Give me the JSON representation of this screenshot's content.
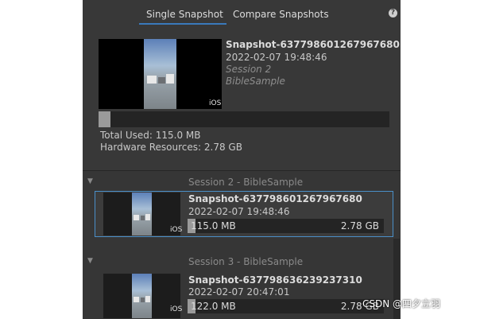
{
  "tabs": [
    {
      "label": "Single Snapshot",
      "active": true
    },
    {
      "label": "Compare Snapshots",
      "active": false
    }
  ],
  "help_icon": "?",
  "selected_snapshot": {
    "name": "Snapshot-637798601267967680",
    "date": "2022-02-07 19:48:46",
    "session": "Session 2",
    "project": "BibleSample",
    "platform": "iOS",
    "usage_fraction": 0.04,
    "total_used": "Total Used: 115.0 MB",
    "hardware_resources": "Hardware Resources: 2.78 GB"
  },
  "sessions": [
    {
      "header": "Session 2 - BibleSample",
      "snapshots": [
        {
          "name": "Snapshot-637798601267967680",
          "date": "2022-02-07 19:48:46",
          "platform": "iOS",
          "used": "115.0 MB",
          "total": "2.78 GB",
          "usage_fraction": 0.04,
          "selected": true
        }
      ]
    },
    {
      "header": "Session 3 - BibleSample",
      "snapshots": [
        {
          "name": "Snapshot-637798636239237310",
          "date": "2022-02-07 20:47:01",
          "platform": "iOS",
          "used": "122.0 MB",
          "total": "2.78 GB",
          "usage_fraction": 0.04,
          "selected": false
        }
      ]
    }
  ],
  "watermark": "CSDN @四夕立羽",
  "colors": {
    "panel_bg": "#383838",
    "tab_accent": "#3a79bb",
    "selection_border": "#4a8fc8",
    "bar_fill": "#9a9a9a"
  }
}
